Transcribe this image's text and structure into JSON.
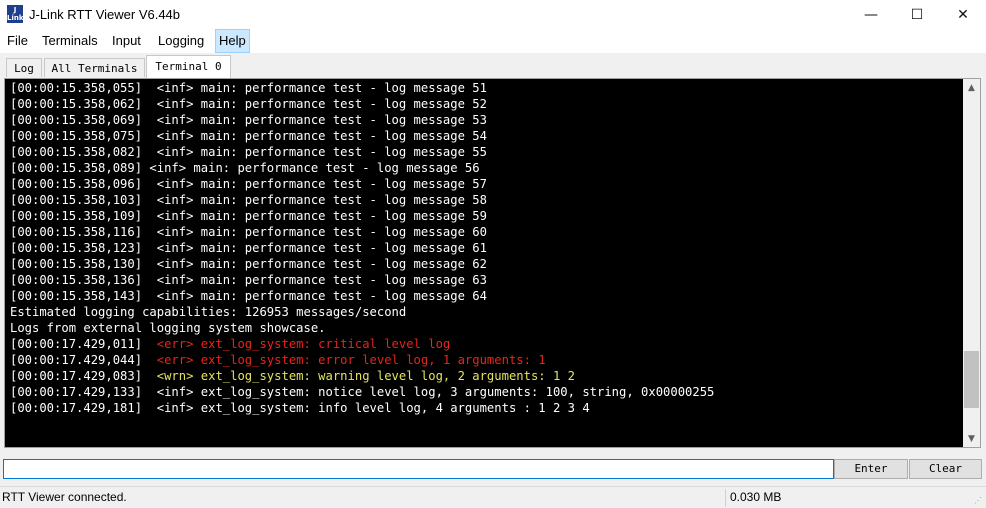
{
  "window": {
    "title": "J-Link RTT Viewer V6.44b",
    "icon_label": "J Link",
    "minimize_symbol": "—",
    "maximize_symbol": "☐",
    "close_symbol": "✕"
  },
  "menu": [
    {
      "label": "File"
    },
    {
      "label": "Terminals"
    },
    {
      "label": "Input"
    },
    {
      "label": "Logging"
    },
    {
      "label": "Help"
    }
  ],
  "tabs": [
    {
      "label": "Log"
    },
    {
      "label": "All Terminals"
    },
    {
      "label": "Terminal 0"
    }
  ],
  "colors": {
    "terminal_bg": "#000000",
    "text_default": "#ffffff",
    "text_error": "#e8241c",
    "text_warning": "#e4e45c",
    "accent": "#0078d7"
  },
  "terminal": {
    "lines": [
      {
        "text": "[00:00:15.358,055]  <inf> main: performance test - log message 51",
        "level": "inf"
      },
      {
        "text": "[00:00:15.358,062]  <inf> main: performance test - log message 52",
        "level": "inf"
      },
      {
        "text": "[00:00:15.358,069]  <inf> main: performance test - log message 53",
        "level": "inf"
      },
      {
        "text": "[00:00:15.358,075]  <inf> main: performance test - log message 54",
        "level": "inf"
      },
      {
        "text": "[00:00:15.358,082]  <inf> main: performance test - log message 55",
        "level": "inf"
      },
      {
        "text": "[00:00:15.358,089] <inf> main: performance test - log message 56",
        "level": "inf"
      },
      {
        "text": "[00:00:15.358,096]  <inf> main: performance test - log message 57",
        "level": "inf"
      },
      {
        "text": "[00:00:15.358,103]  <inf> main: performance test - log message 58",
        "level": "inf"
      },
      {
        "text": "[00:00:15.358,109]  <inf> main: performance test - log message 59",
        "level": "inf"
      },
      {
        "text": "[00:00:15.358,116]  <inf> main: performance test - log message 60",
        "level": "inf"
      },
      {
        "text": "[00:00:15.358,123]  <inf> main: performance test - log message 61",
        "level": "inf"
      },
      {
        "text": "[00:00:15.358,130]  <inf> main: performance test - log message 62",
        "level": "inf"
      },
      {
        "text": "[00:00:15.358,136]  <inf> main: performance test - log message 63",
        "level": "inf"
      },
      {
        "text": "[00:00:15.358,143]  <inf> main: performance test - log message 64",
        "level": "inf"
      },
      {
        "text": "Estimated logging capabilities: 126953 messages/second",
        "level": "plain"
      },
      {
        "text": "Logs from external logging system showcase.",
        "level": "plain"
      },
      {
        "prefix": "[00:00:17.429,011]  ",
        "text": "<err> ext_log_system: critical level log",
        "level": "err"
      },
      {
        "prefix": "[00:00:17.429,044]  ",
        "text": "<err> ext_log_system: error level log, 1 arguments: 1",
        "level": "err"
      },
      {
        "prefix": "[00:00:17.429,083]  ",
        "text": "<wrn> ext_log_system: warning level log, 2 arguments: 1 2",
        "level": "wrn"
      },
      {
        "text": "[00:00:17.429,133]  <inf> ext_log_system: notice level log, 3 arguments: 100, string, 0x00000255",
        "level": "inf"
      },
      {
        "text": "[00:00:17.429,181]  <inf> ext_log_system: info level log, 4 arguments : 1 2 3 4",
        "level": "inf"
      }
    ],
    "scroll_position": 0.92,
    "scroll_visible_fraction": 0.17
  },
  "input": {
    "value": "",
    "enter_label": "Enter",
    "clear_label": "Clear"
  },
  "status": {
    "text": "RTT Viewer connected.",
    "data_size": "0.030 MB"
  }
}
